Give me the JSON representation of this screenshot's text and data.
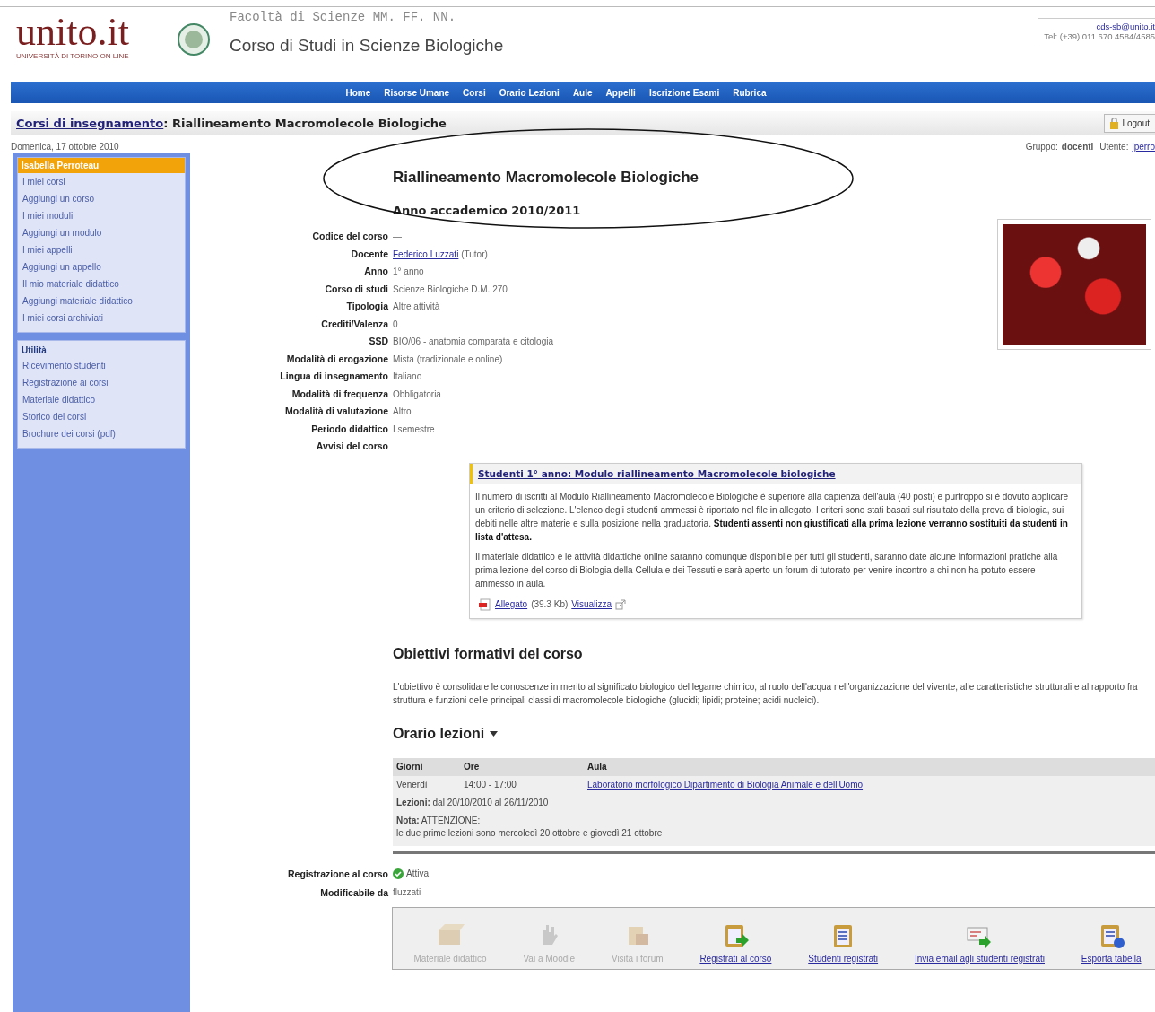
{
  "header": {
    "logo": "unito.it",
    "logo_subtitle": "UNIVERSITÀ DI TORINO ON LINE",
    "faculty": "Facoltà di Scienze MM. FF. NN.",
    "course_of_study": "Corso di Studi in Scienze Biologiche",
    "email": "cds-sb@unito.it",
    "phone": "Tel: (+39) 011 670 4584/4585"
  },
  "nav": [
    "Home",
    "Risorse Umane",
    "Corsi",
    "Orario Lezioni",
    "Aule",
    "Appelli",
    "Iscrizione Esami",
    "Rubrica"
  ],
  "breadcrumb": {
    "link": "Corsi di insegnamento",
    "current": ": Riallineamento Macromolecole Biologiche",
    "logout": "Logout"
  },
  "info_bar": {
    "date": "Domenica, 17 ottobre 2010",
    "group_label": "Gruppo:",
    "group": "docenti",
    "user_label": "Utente:",
    "user": "iperro"
  },
  "sidebar": [
    {
      "kind": "user",
      "title": "Isabella Perroteau",
      "items": [
        "I miei corsi",
        "Aggiungi un corso",
        "I miei moduli",
        "Aggiungi un modulo",
        "I miei appelli",
        "Aggiungi un appello",
        "Il mio materiale didattico",
        "Aggiungi materiale didattico",
        "I miei corsi archiviati"
      ]
    },
    {
      "kind": "section",
      "title": "Utilità",
      "items": [
        "Ricevimento studenti",
        "Registrazione ai corsi",
        "Materiale didattico",
        "Storico dei corsi",
        "Brochure dei corsi (pdf)"
      ]
    }
  ],
  "course": {
    "title": "Riallineamento Macromolecole Biologiche",
    "year": "Anno accademico 2010/2011",
    "info": [
      {
        "label": "Codice del corso",
        "value": "—"
      },
      {
        "label": "Docente",
        "link": "Federico Luzzati",
        "value": "(Tutor)"
      },
      {
        "label": "Anno",
        "value": "1° anno"
      },
      {
        "label": "Corso di studi",
        "value": "Scienze Biologiche D.M. 270"
      },
      {
        "label": "Tipologia",
        "value": "Altre attività"
      },
      {
        "label": "Crediti/Valenza",
        "value": "0"
      },
      {
        "label": "SSD",
        "value": "BIO/06 - anatomia comparata e citologia"
      },
      {
        "label": "Modalità di erogazione",
        "value": "Mista (tradizionale e online)"
      },
      {
        "label": "Lingua di insegnamento",
        "value": "Italiano"
      },
      {
        "label": "Modalità di frequenza",
        "value": "Obbligatoria"
      },
      {
        "label": "Modalità di valutazione",
        "value": "Altro"
      },
      {
        "label": "Periodo didattico",
        "value": "I semestre"
      },
      {
        "label": "Avvisi del corso"
      }
    ]
  },
  "notice": {
    "title": "Studenti 1° anno: Modulo riallineamento Macromolecole biologiche",
    "paragraphs": [
      "Il numero di iscritti al Modulo Riallineamento Macromolecole Biologiche è superiore alla capienza dell'aula (40 posti) e purtroppo si è dovuto applicare un criterio di selezione. L'elenco degli studenti ammessi è riportato nel file in allegato. I criteri sono stati basati sul risultato della prova di biologia, sui debiti nelle altre materie e sulla posizione nella graduatoria. **Studenti assenti non giustificati alla prima lezione verranno sostituiti da studenti in lista d'attesa.**",
      "Il materiale didattico e le attività didattiche online saranno comunque disponibile per tutti gli studenti, saranno date alcune informazioni pratiche alla prima lezione del corso di Biologia della Cellula e dei Tessuti e sarà aperto un forum di tutorato per venire incontro a chi non ha potuto essere ammesso in aula."
    ],
    "attachment": "Allegato",
    "size": "(39.3 Kb)",
    "view": "Visualizza"
  },
  "objectives": {
    "heading": "Obiettivi formativi del corso",
    "text": "L'obiettivo è consolidare le conoscenze in merito al significato biologico del legame chimico, al ruolo dell'acqua nell'organizzazione del vivente, alle caratteristiche strutturali e al rapporto fra struttura e funzioni delle principali classi di macromolecole biologiche (glucidi; lipidi; proteine; acidi nucleici)."
  },
  "schedule": {
    "heading": "Orario lezioni",
    "columns": [
      "Giorni",
      "Ore",
      "Aula"
    ],
    "rows": [
      {
        "day": "Venerdì",
        "hours": "14:00 - 17:00",
        "room": "Laboratorio morfologico Dipartimento di Biologia Animale e dell'Uomo"
      }
    ],
    "lessons_label": "Lezioni:",
    "lessons": "dal 20/10/2010 al 26/11/2010",
    "note_label": "Nota:",
    "note_lines": [
      "ATTENZIONE:",
      "le due prime lezioni sono mercoledì 20 ottobre e giovedì 21 ottobre"
    ]
  },
  "registration": {
    "label": "Registrazione al corso",
    "status": "Attiva",
    "active": true,
    "editable_label": "Modificabile da",
    "editable_by": "fluzzati"
  },
  "actions": [
    {
      "kind": "box",
      "label": "Materiale didattico",
      "disabled": true
    },
    {
      "kind": "hand",
      "label": "Vai a Moodle",
      "disabled": true
    },
    {
      "kind": "forum",
      "label": "Visita i forum",
      "disabled": true
    },
    {
      "kind": "register",
      "label": "Registrati al corso",
      "disabled": false
    },
    {
      "kind": "list",
      "label": "Studenti registrati",
      "disabled": false
    },
    {
      "kind": "email",
      "label": "Invia email agli studenti registrati",
      "disabled": false
    },
    {
      "kind": "export",
      "label": "Esporta tabella",
      "disabled": false
    }
  ]
}
